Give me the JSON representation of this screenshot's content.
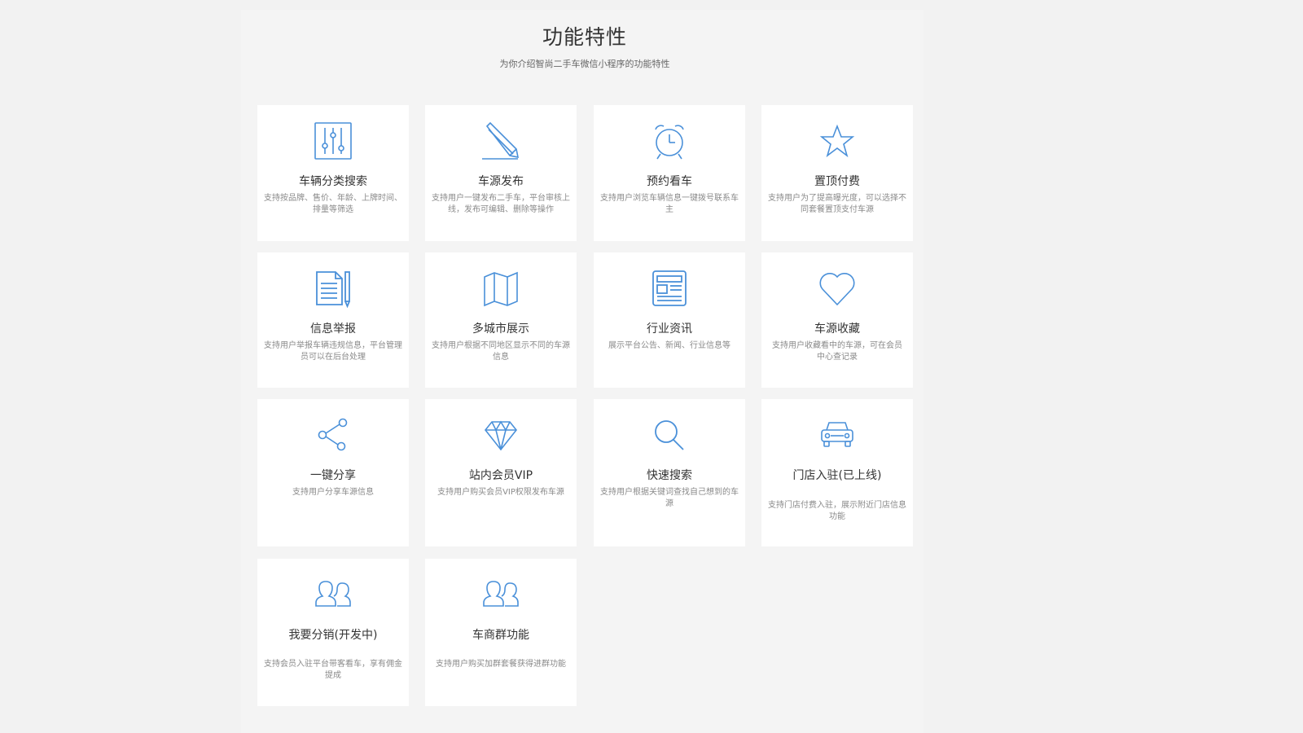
{
  "header": {
    "title": "功能特性",
    "subtitle": "为你介绍智尚二手车微信小程序的功能特性"
  },
  "colors": {
    "accent": "#4a90d9",
    "background": "#f2f2f2",
    "card": "#ffffff"
  },
  "features": [
    {
      "icon": "sliders-icon",
      "title": "车辆分类搜索",
      "desc": "支持按品牌、售价、年龄、上牌时间、排量等筛选"
    },
    {
      "icon": "pencil-icon",
      "title": "车源发布",
      "desc": "支持用户一键发布二手车，平台审核上线，发布可编辑、删除等操作"
    },
    {
      "icon": "alarm-clock-icon",
      "title": "预约看车",
      "desc": "支持用户浏览车辆信息一键拨号联系车主"
    },
    {
      "icon": "star-icon",
      "title": "置顶付费",
      "desc": "支持用户为了提高曝光度，可以选择不同套餐置顶支付车源"
    },
    {
      "icon": "document-icon",
      "title": "信息举报",
      "desc": "支持用户举报车辆违规信息，平台管理员可以在后台处理"
    },
    {
      "icon": "map-icon",
      "title": "多城市展示",
      "desc": "支持用户根据不同地区显示不同的车源信息"
    },
    {
      "icon": "newspaper-icon",
      "title": "行业资讯",
      "desc": "展示平台公告、新闻、行业信息等"
    },
    {
      "icon": "heart-icon",
      "title": "车源收藏",
      "desc": "支持用户收藏看中的车源，可在会员 中心查记录"
    },
    {
      "icon": "share-icon",
      "title": "一键分享",
      "desc": "支持用户分享车源信息"
    },
    {
      "icon": "diamond-icon",
      "title": "站内会员VIP",
      "desc": "支持用户购买会员VIP权限发布车源"
    },
    {
      "icon": "search-icon",
      "title": "快速搜索",
      "desc": "支持用户根据关键词查找自己想到的车源"
    },
    {
      "icon": "car-icon",
      "title": "门店入驻(已上线)",
      "desc": "支持门店付费入驻，展示附近门店信息功能"
    },
    {
      "icon": "users-icon",
      "title": "我要分销(开发中)",
      "desc": "支持会员入驻平台带客看车，享有佣金提成"
    },
    {
      "icon": "users-icon",
      "title": "车商群功能",
      "desc": "支持用户购买加群套餐获得进群功能"
    }
  ]
}
